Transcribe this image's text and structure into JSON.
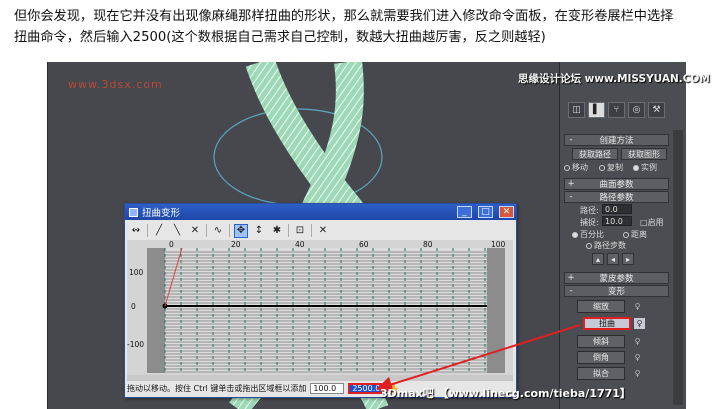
{
  "intro": {
    "line1": "但你会发现，现在它并没有出现像麻绳那样扭曲的形状，那么就需要我们进入修改命令面板，在变形卷展栏中选择",
    "line2": "扭曲命令，然后输入2500(这个数根据自己需求自己控制，数越大扭曲越厉害，反之则越轻)"
  },
  "viewport": {
    "watermark": "www.3dsx.com"
  },
  "watermark_top": "思缘设计论坛 www.MISSYUAN.COM",
  "watermark_bottom": "3Dmax吧 【www.linecg.com/tieba/1771】",
  "command_panel": {
    "creation_method": {
      "title": "创建方法",
      "get_path": "获取路径",
      "get_shape": "获取图形",
      "move": "移动",
      "copy": "复制",
      "instance": "实例"
    },
    "surface_params": "曲面参数",
    "path_params": {
      "title": "路径参数",
      "path_label": "路径:",
      "path_value": "0.0",
      "snap_label": "捕捉:",
      "snap_value": "10.0",
      "enable": "启用",
      "percent": "百分比",
      "distance": "距离",
      "path_steps": "路径步数"
    },
    "skin_params": "蒙皮参数",
    "deformations": {
      "title": "变形",
      "scale": "缩放",
      "twist": "扭曲",
      "teeter": "倾斜",
      "bevel": "倒角",
      "fit": "拟合"
    }
  },
  "dialog": {
    "title": "扭曲变形",
    "axis_top": [
      "0",
      "20",
      "40",
      "60",
      "80",
      "100"
    ],
    "axis_left": [
      "100",
      "0",
      "-100"
    ],
    "status_text": "拖动以移动。按住 Ctrl 键单击或拖出区域框以添加",
    "field1": "100.0",
    "field2": "2500.0"
  }
}
